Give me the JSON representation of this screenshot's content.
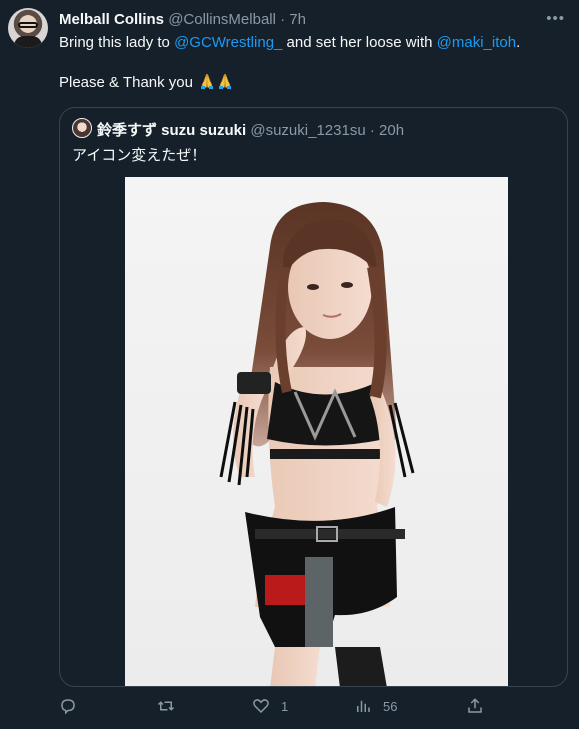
{
  "tweet": {
    "author_name": "Melball Collins",
    "author_handle": "@CollinsMelball",
    "dot": "·",
    "time": "7h",
    "more_label": "•••",
    "text_part1": "Bring this lady to ",
    "mention1": "@GCWrestling_",
    "text_part2": " and set her loose with ",
    "mention2": "@maki_itoh",
    "text_part3": ".",
    "text_line2": "Please & Thank you",
    "emojis": [
      "folded-hands-emoji",
      "folded-hands-emoji"
    ]
  },
  "quote": {
    "author_name": "鈴季すず suzu suzuki",
    "author_handle": "@suzuki_1231su",
    "dot": "·",
    "time": "20h",
    "text": "アイコン変えたぜ！",
    "image": "photo-of-wrestler-in-black-ring-gear"
  },
  "actions": {
    "reply_count": "",
    "retweet_count": "",
    "like_count": "1",
    "views_count": "56",
    "icons": [
      "reply-icon",
      "retweet-icon",
      "like-icon",
      "views-icon",
      "share-icon"
    ]
  },
  "colors": {
    "background": "#15202b",
    "text": "#f7f9f9",
    "secondary": "#8b98a5",
    "link": "#1d9bf0",
    "border": "#38444d"
  }
}
